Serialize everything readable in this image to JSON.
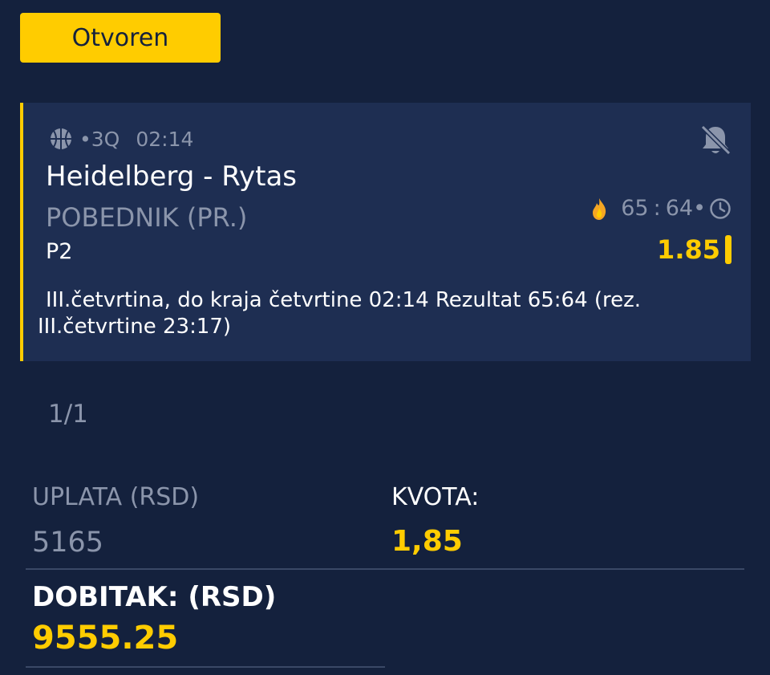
{
  "status_button": {
    "label": "Otvoren"
  },
  "colors": {
    "background": "#14213d",
    "card": "#1e2e52",
    "accent": "#ffcc00",
    "muted": "#8b95ab"
  },
  "event": {
    "sport_icon": "basketball-icon",
    "period": "•3Q",
    "time": "02:14",
    "alert_icon": "bell-off-icon",
    "teams": "Heidelberg - Rytas",
    "market": "POBEDNIK (PR.)",
    "live_icon": "flame-icon",
    "score_home": "65",
    "score_separator": ":",
    "score_away": "64",
    "score_dot": "•",
    "clock_icon": "clock-icon",
    "pick": "P2",
    "odd": "1.85",
    "description": "III.četvrtina, do kraja četvrtine 02:14 Rezultat 65:64 (rez. III.četvrtine 23:17)"
  },
  "pagination": "1/1",
  "summary": {
    "stake_label": "UPLATA (RSD)",
    "stake_value": "5165",
    "odds_label": "KVOTA:",
    "odds_value": "1,85",
    "payout_label": "DOBITAK: (RSD)",
    "payout_value": "9555.25"
  }
}
